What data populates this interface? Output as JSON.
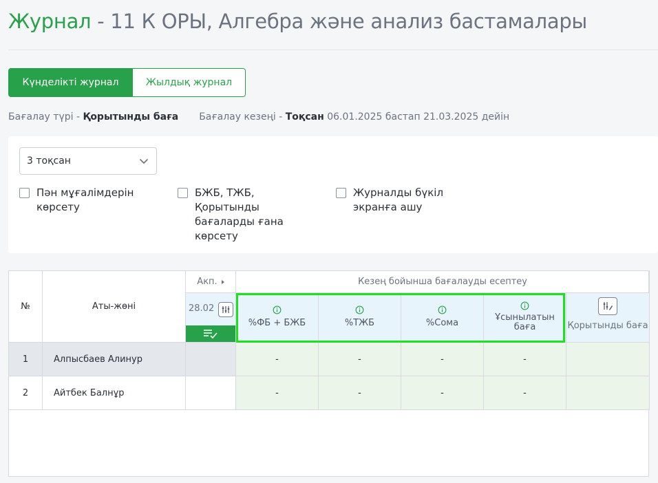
{
  "header": {
    "title_main": "Журнал",
    "title_sep": " - ",
    "title_rest": "11 К ОРЫ, Алгебра және анализ бастамалары"
  },
  "tabs": [
    {
      "label": "Күнделікті журнал",
      "active": true
    },
    {
      "label": "Жылдық журнал",
      "active": false
    }
  ],
  "meta": {
    "eval_type_label": "Бағалау түрі - ",
    "eval_type_value": "Қорытынды баға",
    "period_label": "Бағалау кезеңі - ",
    "period_value": "Тоқсан",
    "period_range": " 06.01.2025 бастап 21.03.2025 дейін"
  },
  "filters": {
    "quarter_select": "3 тоқсан",
    "checkboxes": [
      {
        "label": "Пән мұғалімдерін көрсету",
        "checked": false
      },
      {
        "label": "БЖБ, ТЖБ, Қорытынды бағаларды ғана көрсету",
        "checked": false
      },
      {
        "label": "Журналды бүкіл экранға ашу",
        "checked": false
      }
    ]
  },
  "table": {
    "col_num": "№",
    "col_name": "Аты-жөні",
    "col_akp": "Акп.",
    "col_period": "Кезең бойынша бағалауды есептеу",
    "date": "28.02",
    "metrics": [
      "%ФБ + БЖБ",
      "%ТЖБ",
      "%Сома",
      "Ұсынылатын баға"
    ],
    "final_grade": "Қорытынды баға",
    "rows": [
      {
        "num": "1",
        "name": "Алпысбаев Алинур",
        "values": [
          "-",
          "-",
          "-",
          "-"
        ],
        "final": ""
      },
      {
        "num": "2",
        "name": "Айтбек Балнұр",
        "values": [
          "-",
          "-",
          "-",
          "-"
        ],
        "final": ""
      }
    ]
  },
  "colors": {
    "accent": "#27a24a",
    "highlight_outline": "#1ee01e",
    "header_blue": "#e8f4fc",
    "grade_green": "#ebf5ea"
  }
}
